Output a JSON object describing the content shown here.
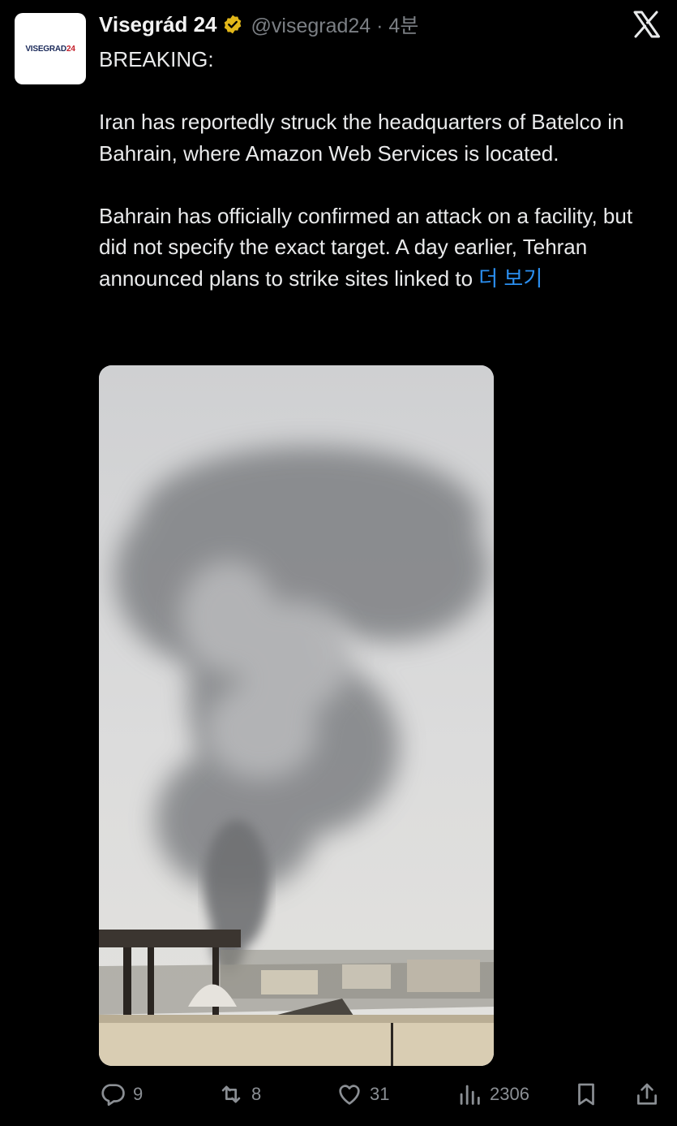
{
  "author": {
    "avatar_logo": "VISEGRAD",
    "avatar_logo_num": "24",
    "name": "Visegrád 24",
    "handle_time": "@visegrad24 · 4분"
  },
  "tweet": {
    "text": "BREAKING:\n\nIran has reportedly struck the headquarters of Batelco in Bahrain, where Amazon Web Services is located.\n\nBahrain has officially confirmed an attack on a facility, but did not specify the exact target. A day earlier, Tehran announced plans to strike sites linked to ",
    "show_more": "더 보기"
  },
  "media": {
    "alt": "Photo of a large grey smoke plume rising above rooftops"
  },
  "actions": {
    "replies": "9",
    "reposts": "8",
    "likes": "31",
    "views": "2306"
  },
  "colors": {
    "link": "#2b8ff0",
    "background": "#000000",
    "muted": "#8b8f94",
    "verified": "#e2b719"
  }
}
